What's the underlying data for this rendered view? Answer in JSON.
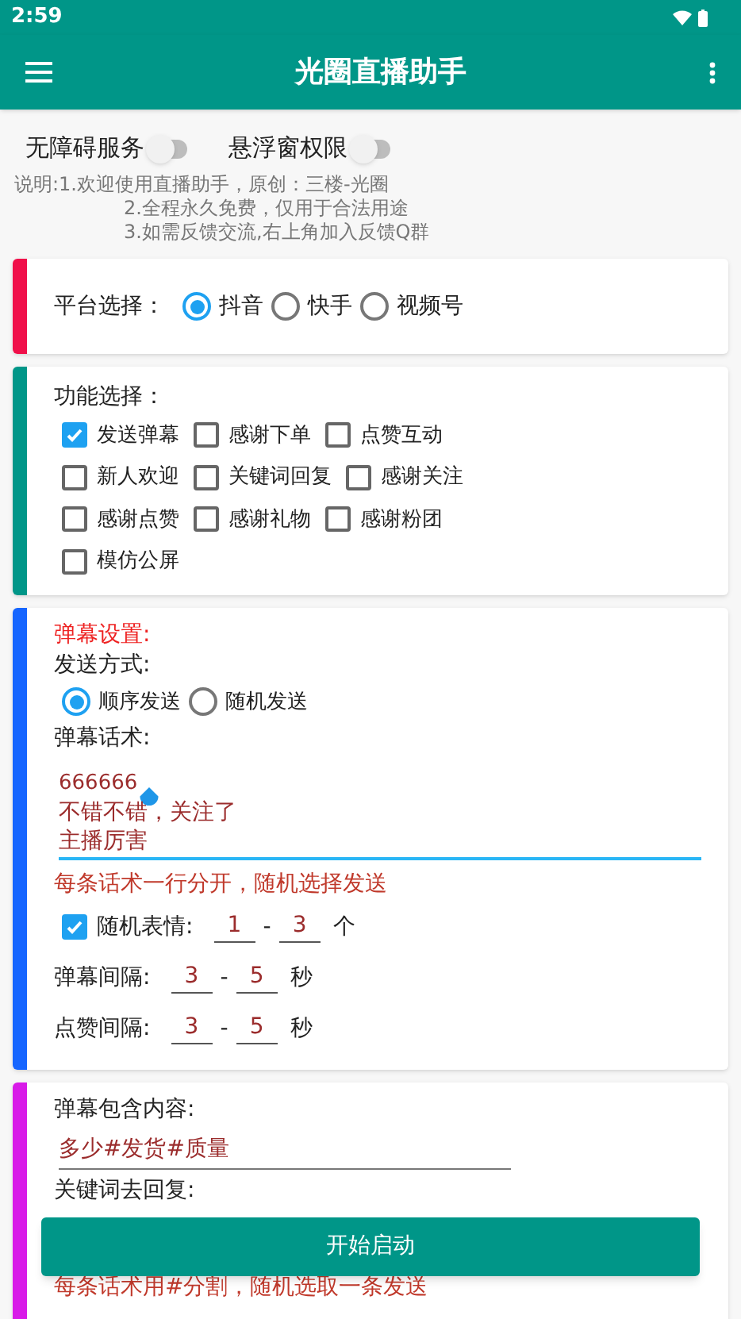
{
  "status_bar": {
    "time": "2:59"
  },
  "app_bar": {
    "title": "光圈直播助手"
  },
  "toggles": [
    {
      "label": "无障碍服务",
      "on": false
    },
    {
      "label": "悬浮窗权限",
      "on": false
    }
  ],
  "notes": [
    "说明:1.欢迎使用直播助手，原创：三楼-光圈",
    "2.全程永久免费，仅用于合法用途",
    "3.如需反馈交流,右上角加入反馈Q群"
  ],
  "platform_card": {
    "color": "#f0104a",
    "label": "平台选择：",
    "options": [
      {
        "label": "抖音",
        "selected": true
      },
      {
        "label": "快手",
        "selected": false
      },
      {
        "label": "视频号",
        "selected": false
      }
    ]
  },
  "function_card": {
    "color": "#009688",
    "label": "功能选择：",
    "rows": [
      [
        {
          "label": "发送弹幕",
          "checked": true
        },
        {
          "label": "感谢下单",
          "checked": false
        },
        {
          "label": "点赞互动",
          "checked": false
        }
      ],
      [
        {
          "label": "新人欢迎",
          "checked": false
        },
        {
          "label": "关键词回复",
          "checked": false
        },
        {
          "label": "感谢关注",
          "checked": false
        }
      ],
      [
        {
          "label": "感谢点赞",
          "checked": false
        },
        {
          "label": "感谢礼物",
          "checked": false
        },
        {
          "label": "感谢粉团",
          "checked": false
        }
      ],
      [
        {
          "label": "模仿公屏",
          "checked": false
        }
      ]
    ]
  },
  "danmu_card": {
    "color": "#1565ff",
    "title": "弹幕设置:",
    "send_mode_label": "发送方式:",
    "send_modes": [
      {
        "label": "顺序发送",
        "selected": true
      },
      {
        "label": "随机发送",
        "selected": false
      }
    ],
    "script_label": "弹幕话术:",
    "script_lines": [
      "666666",
      "不错不错，关注了",
      "主播厉害"
    ],
    "hint": "每条话术一行分开，随机选择发送",
    "emoji": {
      "checked": true,
      "label": "随机表情:",
      "min": "1",
      "sep": "-",
      "max": "3",
      "unit": "个"
    },
    "intervals": [
      {
        "label": "弹幕间隔:",
        "min": "3",
        "sep": "-",
        "max": "5",
        "unit": "秒"
      },
      {
        "label": "点赞间隔:",
        "min": "3",
        "sep": "-",
        "max": "5",
        "unit": "秒"
      }
    ]
  },
  "keyword_card": {
    "color": "#d81ae8",
    "contains_label": "弹幕包含内容:",
    "contains_value": "多少#发货#质量",
    "reply_label": "关键词去回复:",
    "hint": "每条话术用#分割，随机选取一条发送"
  },
  "start_button": {
    "label": "开始启动"
  }
}
